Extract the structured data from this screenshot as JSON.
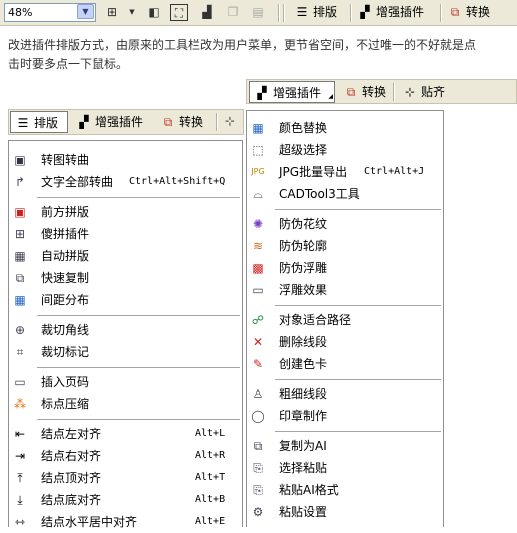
{
  "toolbar": {
    "zoom_value": "48%",
    "items": [
      {
        "label": "排版",
        "icon": "typeset-icon"
      },
      {
        "label": "增强插件",
        "icon": "plugin-icon"
      },
      {
        "label": "转换",
        "icon": "convert-icon"
      }
    ]
  },
  "paragraph": {
    "line1": "改进插件排版方式，由原来的工具栏改为用户菜单，更节省空间，不过唯一的不好就是点",
    "line2": "击时要多点一下鼠标。"
  },
  "bar_right": {
    "items": [
      {
        "label": "增强插件",
        "icon": "plugin-icon"
      },
      {
        "label": "转换",
        "icon": "convert-icon"
      },
      {
        "label": "贴齐",
        "icon": "snap-icon"
      }
    ]
  },
  "bar_left": {
    "items": [
      {
        "label": "排版",
        "icon": "typeset-icon"
      },
      {
        "label": "增强插件",
        "icon": "plugin-icon"
      },
      {
        "label": "转换",
        "icon": "convert-icon"
      }
    ]
  },
  "menu_left": {
    "items": [
      {
        "label": "转图转曲",
        "icon": "image-curve-icon"
      },
      {
        "label": "文字全部转曲",
        "shortcut": "Ctrl+Alt+Shift+Q",
        "icon": "text-curve-icon"
      },
      {
        "label": "前方拼版",
        "icon": "front-impose-icon"
      },
      {
        "label": "傻拼插件",
        "icon": "quick-impose-icon"
      },
      {
        "label": "自动拼版",
        "icon": "auto-impose-icon"
      },
      {
        "label": "快速复制",
        "icon": "quick-copy-icon"
      },
      {
        "label": "间距分布",
        "icon": "spacing-icon"
      },
      {
        "label": "裁切角线",
        "icon": "crop-corner-icon"
      },
      {
        "label": "裁切标记",
        "icon": "crop-mark-icon"
      },
      {
        "label": "插入页码",
        "icon": "page-number-icon"
      },
      {
        "label": "标点压缩",
        "icon": "punctuation-icon"
      },
      {
        "label": "结点左对齐",
        "shortcut": "Alt+L",
        "icon": "align-left-icon"
      },
      {
        "label": "结点右对齐",
        "shortcut": "Alt+R",
        "icon": "align-right-icon"
      },
      {
        "label": "结点顶对齐",
        "shortcut": "Alt+T",
        "icon": "align-top-icon"
      },
      {
        "label": "结点底对齐",
        "shortcut": "Alt+B",
        "icon": "align-bottom-icon"
      },
      {
        "label": "结点水平居中对齐",
        "shortcut": "Alt+E",
        "icon": "align-hcenter-icon"
      }
    ]
  },
  "menu_right": {
    "items": [
      {
        "label": "颜色替换",
        "icon": "color-replace-icon"
      },
      {
        "label": "超级选择",
        "icon": "super-select-icon"
      },
      {
        "label": "JPG批量导出",
        "shortcut": "Ctrl+Alt+J",
        "icon": "jpg-export-icon"
      },
      {
        "label": "CADTool3工具",
        "icon": "cad-tool-icon"
      },
      {
        "label": "防伪花纹",
        "icon": "guilloche-icon"
      },
      {
        "label": "防伪轮廓",
        "icon": "security-outline-icon"
      },
      {
        "label": "防伪浮雕",
        "icon": "security-relief-icon"
      },
      {
        "label": "浮雕效果",
        "icon": "emboss-icon"
      },
      {
        "label": "对象适合路径",
        "icon": "fit-path-icon"
      },
      {
        "label": "删除线段",
        "icon": "delete-segment-icon"
      },
      {
        "label": "创建色卡",
        "icon": "color-card-icon"
      },
      {
        "label": "粗细线段",
        "icon": "line-weight-icon"
      },
      {
        "label": "印章制作",
        "icon": "stamp-icon"
      },
      {
        "label": "复制为AI",
        "icon": "copy-ai-icon"
      },
      {
        "label": "选择粘贴",
        "icon": "paste-special-icon"
      },
      {
        "label": "粘贴AI格式",
        "icon": "paste-ai-icon"
      },
      {
        "label": "粘贴设置",
        "icon": "paste-settings-icon"
      }
    ]
  }
}
